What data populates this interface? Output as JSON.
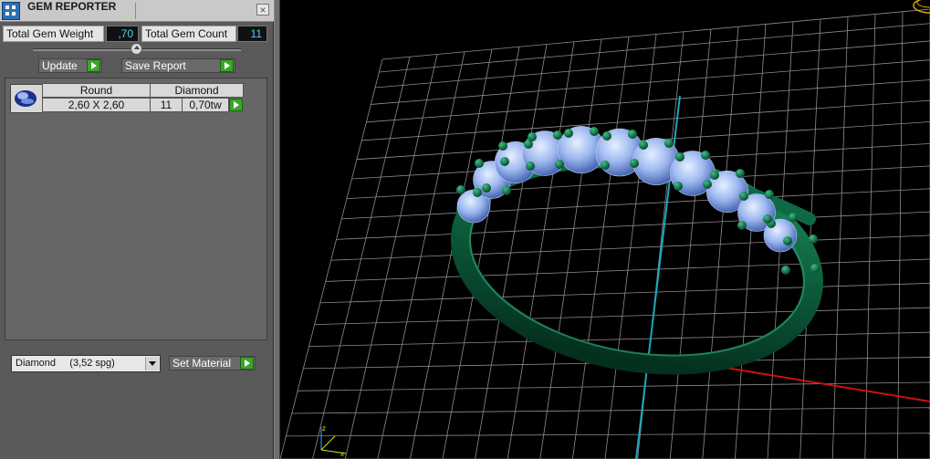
{
  "panel": {
    "title": "GEM REPORTER",
    "close_symbol": "×",
    "total_weight_label": "Total Gem Weight",
    "total_weight_value": ",70",
    "total_count_label": "Total Gem Count",
    "total_count_value": "11",
    "update_label": "Update",
    "save_report_label": "Save Report",
    "gem_row": {
      "shape_header": "Round",
      "material_header": "Diamond",
      "size": "2,60 X 2,60",
      "count": "11",
      "weight": "0,70tw"
    },
    "material_select_value": "Diamond     (3,52 spg)",
    "set_material_label": "Set Material"
  },
  "colors": {
    "panel_bg": "#5a5a5a",
    "value_text": "#4ad3ff",
    "play_green": "#3ba52a",
    "grid": "#8c8c8c",
    "axis_cyan": "#1aa8b8",
    "axis_red": "#d01010",
    "metal": "#0f6a45",
    "gem": "#9db8f0"
  }
}
